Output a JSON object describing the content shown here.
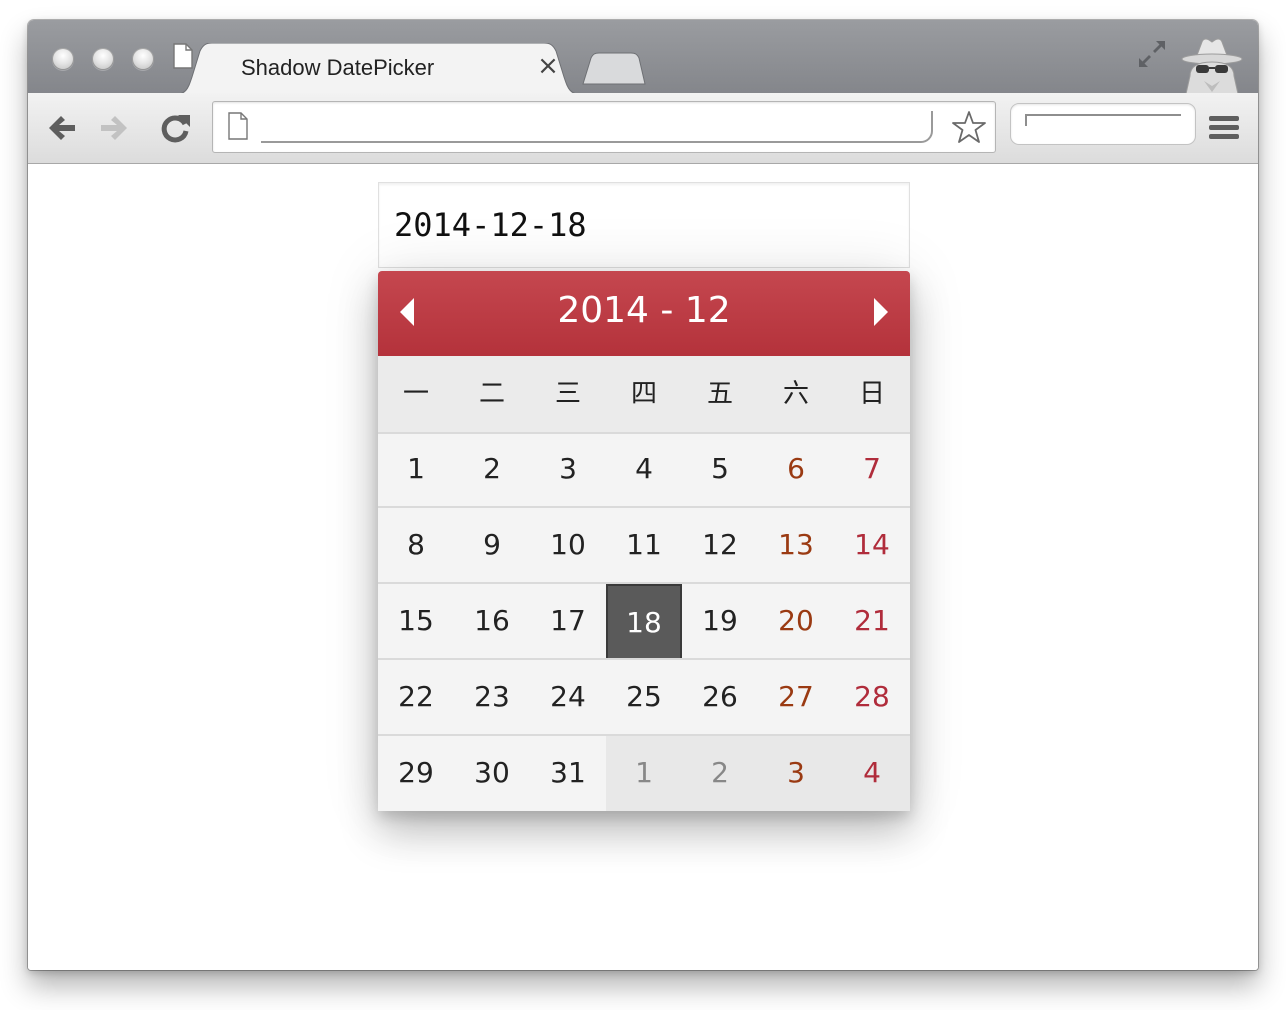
{
  "browser": {
    "tab_title": "Shadow DatePicker",
    "tab_close": "×",
    "address": "",
    "search": ""
  },
  "datepicker": {
    "input_value": "2014-12-18",
    "header_title": "2014 - 12",
    "weekdays": [
      "一",
      "二",
      "三",
      "四",
      "五",
      "六",
      "日"
    ],
    "weeks": [
      [
        "1",
        "2",
        "3",
        "4",
        "5",
        "6",
        "7"
      ],
      [
        "8",
        "9",
        "10",
        "11",
        "12",
        "13",
        "14"
      ],
      [
        "15",
        "16",
        "17",
        "18",
        "19",
        "20",
        "21"
      ],
      [
        "22",
        "23",
        "24",
        "25",
        "26",
        "27",
        "28"
      ],
      [
        "29",
        "30",
        "31",
        "1",
        "2",
        "3",
        "4"
      ]
    ],
    "selected_day": "18",
    "colors": {
      "header": "#be3d46",
      "saturday": "#9a3a12",
      "sunday": "#b02c3b",
      "selected_bg": "#5a5a5a"
    }
  },
  "icons": {
    "back": "arrow-left-icon",
    "forward": "arrow-right-icon",
    "reload": "reload-icon",
    "page": "page-icon",
    "bookmark": "star-icon",
    "menu": "hamburger-menu-icon",
    "fullscreen": "fullscreen-icon",
    "incognito": "incognito-icon",
    "prev_month": "caret-left-icon",
    "next_month": "caret-right-icon"
  }
}
